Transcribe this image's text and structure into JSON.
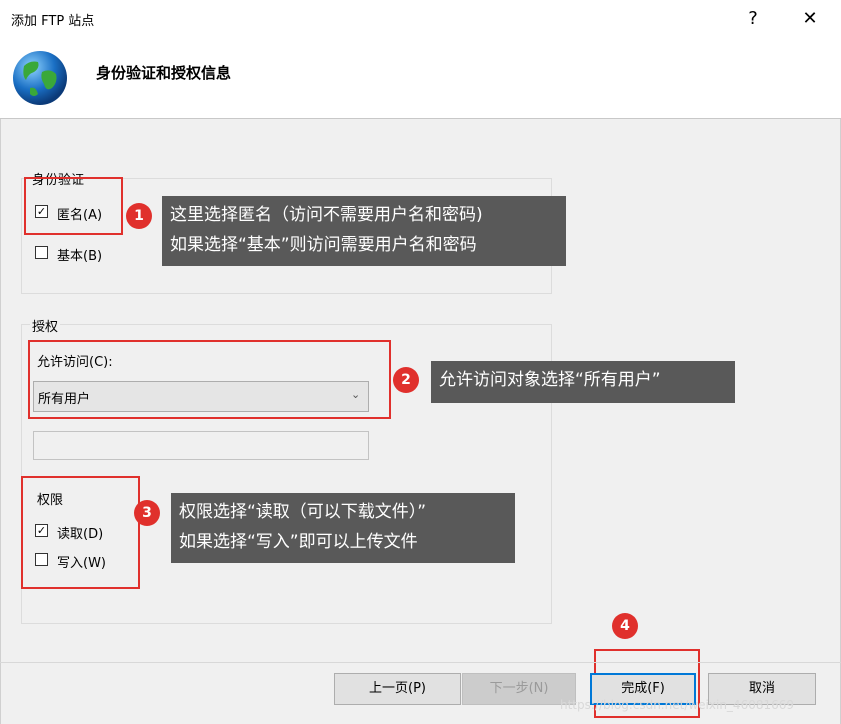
{
  "window": {
    "title": "添加 FTP 站点",
    "help_glyph": "?",
    "close_glyph": "✕"
  },
  "header": {
    "title": "身份验证和授权信息"
  },
  "authentication": {
    "group_label": "身份验证",
    "anonymous": {
      "label": "匿名(A)",
      "checked": true
    },
    "basic": {
      "label": "基本(B)",
      "checked": false
    }
  },
  "authorization": {
    "group_label": "授权",
    "allow_access_label": "允许访问(C):",
    "allow_access_value": "所有用户",
    "allow_access_textbox": "",
    "permissions_label": "权限",
    "read": {
      "label": "读取(D)",
      "checked": true
    },
    "write": {
      "label": "写入(W)",
      "checked": false
    }
  },
  "annotations": [
    {
      "number": "1",
      "lines": [
        "这里选择匿名（访问不需要用户名和密码)",
        "如果选择“基本”则访问需要用户名和密码"
      ]
    },
    {
      "number": "2",
      "lines": [
        "允许访问对象选择“所有用户”"
      ]
    },
    {
      "number": "3",
      "lines": [
        "权限选择“读取（可以下载文件）”",
        "如果选择“写入”即可以上传文件"
      ]
    },
    {
      "number": "4"
    }
  ],
  "buttons": {
    "previous": "上一页(P)",
    "next": "下一步(N)",
    "finish": "完成(F)",
    "cancel": "取消"
  },
  "watermark": "https://blog.csdn.net/weixin_46081669",
  "colors": {
    "annotation_red": "#e0302c",
    "tooltip_bg": "#595959",
    "focus_blue": "#0078d7"
  }
}
